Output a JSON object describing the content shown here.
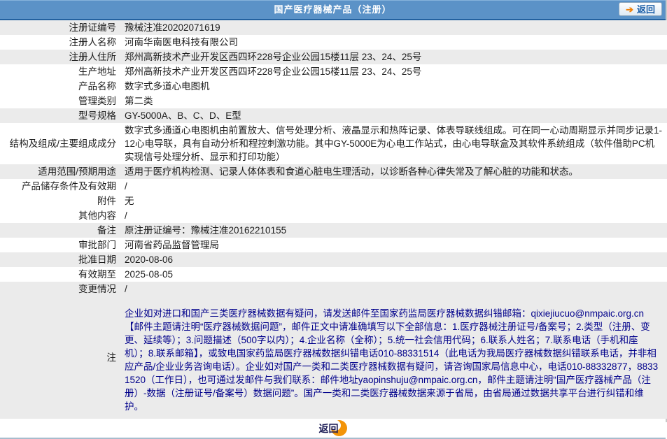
{
  "header": {
    "title": "国产医疗器械产品（注册）",
    "back_label": "返回"
  },
  "icons": {
    "back_arrow": "➔"
  },
  "table": {
    "rows": [
      {
        "label": "注册证编号",
        "value": "豫械注准20202071619",
        "shade": "gray"
      },
      {
        "label": "注册人名称",
        "value": "河南华南医电科技有限公司",
        "shade": "white"
      },
      {
        "label": "注册人住所",
        "value": "郑州高新技术产业开发区西四环228号企业公园15楼11层 23、24、25号",
        "shade": "gray"
      },
      {
        "label": "生产地址",
        "value": "郑州高新技术产业开发区西四环228号企业公园15楼11层 23、24、25号",
        "shade": "white"
      },
      {
        "label": "产品名称",
        "value": "数字式多道心电图机",
        "shade": "white"
      },
      {
        "label": "管理类别",
        "value": "第二类",
        "shade": "white"
      },
      {
        "label": "型号规格",
        "value": "GY-5000A、B、C、D、E型",
        "shade": "gray"
      },
      {
        "label": "结构及组成/主要组成成分",
        "value": "数字式多通道心电图机由前置放大、信号处理分析、液晶显示和热阵记录、体表导联线组成。可在同一心动周期显示并同步记录1-12心电导联，具有自动分析和程控刺激功能。其中GY-5000E为心电工作站式，由心电导联盒及其软件系统组成（软件借助PC机实现信号处理分析、显示和打印功能）",
        "shade": "white"
      },
      {
        "label": "适用范围/预期用途",
        "value": "适用于医疗机构检测、记录人体体表和食道心脏电生理活动，以诊断各种心律失常及了解心脏的功能和状态。",
        "shade": "gray"
      },
      {
        "label": "产品储存条件及有效期",
        "value": "/",
        "shade": "white"
      },
      {
        "label": "附件",
        "value": "无",
        "shade": "white"
      },
      {
        "label": "其他内容",
        "value": "/",
        "shade": "white"
      },
      {
        "label": "备注",
        "value": "原注册证编号：豫械注准20162210155",
        "shade": "gray"
      },
      {
        "label": "审批部门",
        "value": "河南省药品监督管理局",
        "shade": "white"
      },
      {
        "label": "批准日期",
        "value": "2020-08-06",
        "shade": "gray"
      },
      {
        "label": "有效期至",
        "value": "2025-08-05",
        "shade": "white"
      },
      {
        "label": "变更情况",
        "value": "/",
        "shade": "gray"
      },
      {
        "label": "注",
        "value": "企业如对进口和国产三类医疗器械数据有疑问，请发送邮件至国家药监局医疗器械数据纠错邮箱：qixiejiucuo@nmpaic.org.cn【邮件主题请注明“医疗器械数据问题”，邮件正文中请准确填写以下全部信息：1.医疗器械注册证号/备案号；2.类型（注册、变更、延续等）；3.问题描述（500字以内）；4.企业名称（全称）；5.统一社会信用代码；6.联系人姓名；7.联系电话（手机和座机）；8.联系邮箱】，或致电国家药监局医疗器械数据纠错电话010-88331514（此电话为我局医疗器械数据纠错联系电话，并非相应产品/企业业务咨询电话）。企业如对国产一类和二类医疗器械数据有疑问，请咨询国家局信息中心，电话010-88332877，88331520（工作日），也可通过发邮件与我们联系：邮件地址yaopinshuju@nmpaic.org.cn，邮件主题请注明“国产医疗器械产品（注册）-数据（注册证号/备案号）数据问题”。国产一类和二类医疗器械数据来源于省局，由省局通过数据共享平台进行纠错和维护。",
        "shade": "gray",
        "note": true
      }
    ]
  },
  "footer": {
    "back_label": "返回"
  },
  "colors": {
    "header_blue": "#5b92c7",
    "header_border_blue": "#23619f",
    "stripe_gray": "#ebebeb",
    "note_text_blue": "#00008b",
    "accent_orange": "#f39408",
    "button_text_blue": "#1c5fa8",
    "bottom_line": "#a7bccd"
  }
}
